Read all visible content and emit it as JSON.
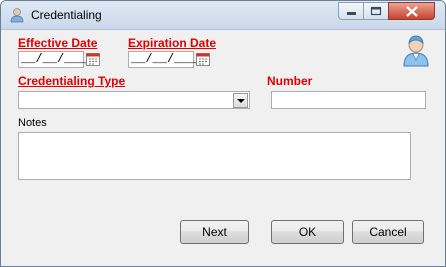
{
  "window": {
    "title": "Credentialing"
  },
  "form": {
    "effective_date_label": "Effective Date",
    "effective_date_value": "__/__/____",
    "expiration_date_label": "Expiration Date",
    "expiration_date_value": "__/__/____",
    "credentialing_type_label": "Credentialing Type",
    "credentialing_type_value": "",
    "number_label": "Number",
    "number_value": "",
    "notes_label": "Notes",
    "notes_value": ""
  },
  "buttons": {
    "next": "Next",
    "ok": "OK",
    "cancel": "Cancel"
  },
  "icons": [
    "user-icon",
    "calendar-icon",
    "chevron-down-icon",
    "minimize-icon",
    "maximize-icon",
    "close-icon"
  ],
  "colors": {
    "required_label": "#e00000",
    "close_button": "#c8432b"
  }
}
